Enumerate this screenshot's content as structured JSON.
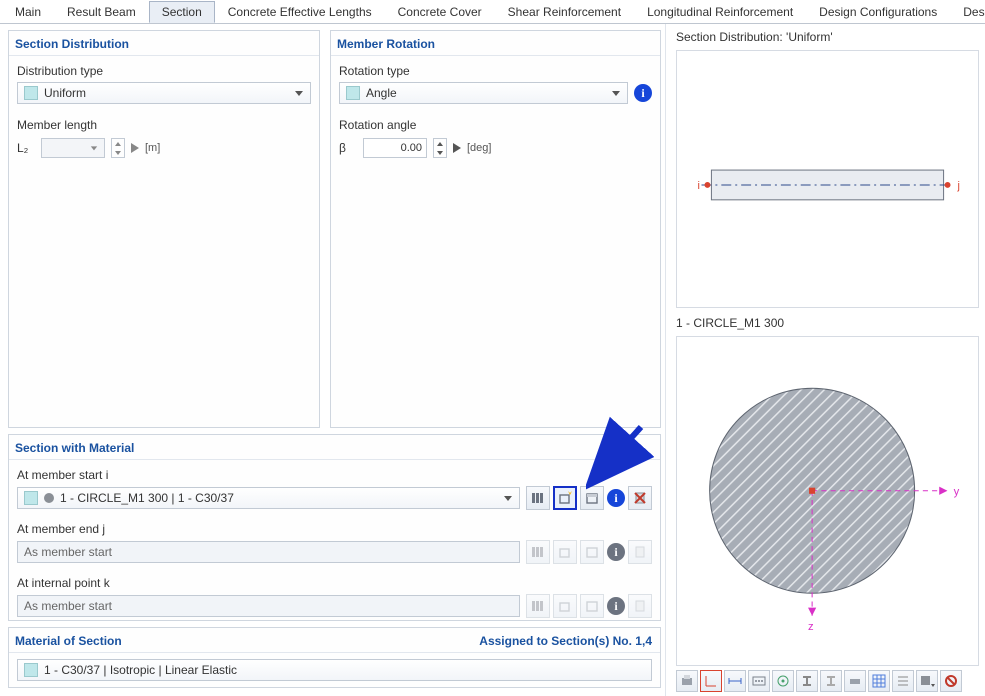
{
  "tabs": {
    "items": [
      "Main",
      "Result Beam",
      "Section",
      "Concrete Effective Lengths",
      "Concrete Cover",
      "Shear Reinforcement",
      "Longitudinal Reinforcement",
      "Design Configurations",
      "Design Support"
    ],
    "active": "Section"
  },
  "sectionDistribution": {
    "title": "Section Distribution",
    "distTypeLabel": "Distribution type",
    "distType": "Uniform",
    "memberLenLabel": "Member length",
    "memberLenSymbol": "L₂",
    "memberLenUnit": "[m]"
  },
  "memberRotation": {
    "title": "Member Rotation",
    "rotTypeLabel": "Rotation type",
    "rotType": "Angle",
    "rotAngleLabel": "Rotation angle",
    "rotSymbol": "β",
    "rotValue": "0.00",
    "rotUnit": "[deg]"
  },
  "sectionWithMaterial": {
    "title": "Section with Material",
    "startLabel": "At member start i",
    "startValue": "1 - CIRCLE_M1 300 | 1 - C30/37",
    "endLabel": "At member end j",
    "endValue": "As member start",
    "internalLabel": "At internal point k",
    "internalValue": "As member start"
  },
  "materialOfSection": {
    "title": "Material of Section",
    "assigned": "Assigned to Section(s) No. 1,4",
    "value": "1 - C30/37 | Isotropic | Linear Elastic"
  },
  "preview": {
    "distTitle": "Section Distribution: 'Uniform'",
    "sectionTitle": "1 - CIRCLE_M1 300",
    "labelI": "i",
    "labelJ": "j",
    "labelY": "y",
    "labelZ": "z"
  }
}
